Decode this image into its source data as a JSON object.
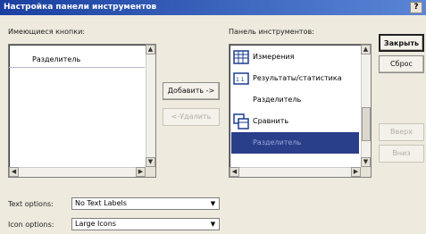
{
  "window": {
    "title": "Настройка панели инструментов",
    "help_label": "?"
  },
  "available": {
    "label": "Имеющиеся кнопки:",
    "items": [
      "Разделитель"
    ]
  },
  "toolbar": {
    "label": "Панель инструментов:",
    "items": [
      {
        "label": "Измерения",
        "icon": "grid-icon"
      },
      {
        "label": "Результаты/статистика",
        "icon": "stats-icon"
      },
      {
        "label": "Разделитель",
        "icon": ""
      },
      {
        "label": "Сравнить",
        "icon": "compare-icon"
      },
      {
        "label": "Разделитель",
        "icon": "",
        "selected": true
      }
    ]
  },
  "buttons": {
    "add": "Добавить ->",
    "remove": "<-Удалить",
    "close": "Закрыть",
    "reset": "Сброс",
    "up": "Вверх",
    "down": "Вниз"
  },
  "options": {
    "text_label": "Text options:",
    "text_value": "No Text Labels",
    "icon_label": "Icon options:",
    "icon_value": "Large Icons"
  },
  "colors": {
    "title_start": "#1a3fa0",
    "title_end": "#5a86d6",
    "selection": "#2a3f8a"
  }
}
